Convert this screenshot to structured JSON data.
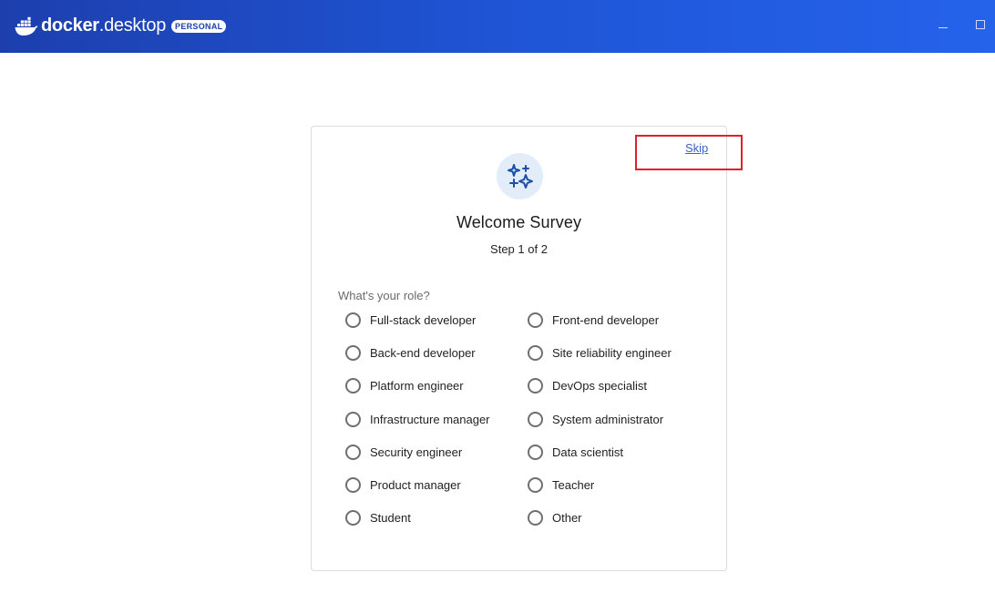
{
  "app": {
    "brand_bold": "docker",
    "brand_light": "desktop",
    "badge": "PERSONAL"
  },
  "survey": {
    "skip_label": "Skip",
    "icon": "sparkles-icon",
    "title": "Welcome Survey",
    "step": "Step 1 of 2",
    "question": "What's your role?",
    "options_left": [
      "Full-stack developer",
      "Back-end developer",
      "Platform engineer",
      "Infrastructure manager",
      "Security engineer",
      "Product manager",
      "Student"
    ],
    "options_right": [
      "Front-end developer",
      "Site reliability engineer",
      "DevOps specialist",
      "System administrator",
      "Data scientist",
      "Teacher",
      "Other"
    ]
  },
  "colors": {
    "titlebar": "#1f56d8",
    "link": "#3b62c4",
    "highlight": "#e0202a",
    "icon_bg": "#e3edf9",
    "icon_fg": "#1d4fa8"
  }
}
